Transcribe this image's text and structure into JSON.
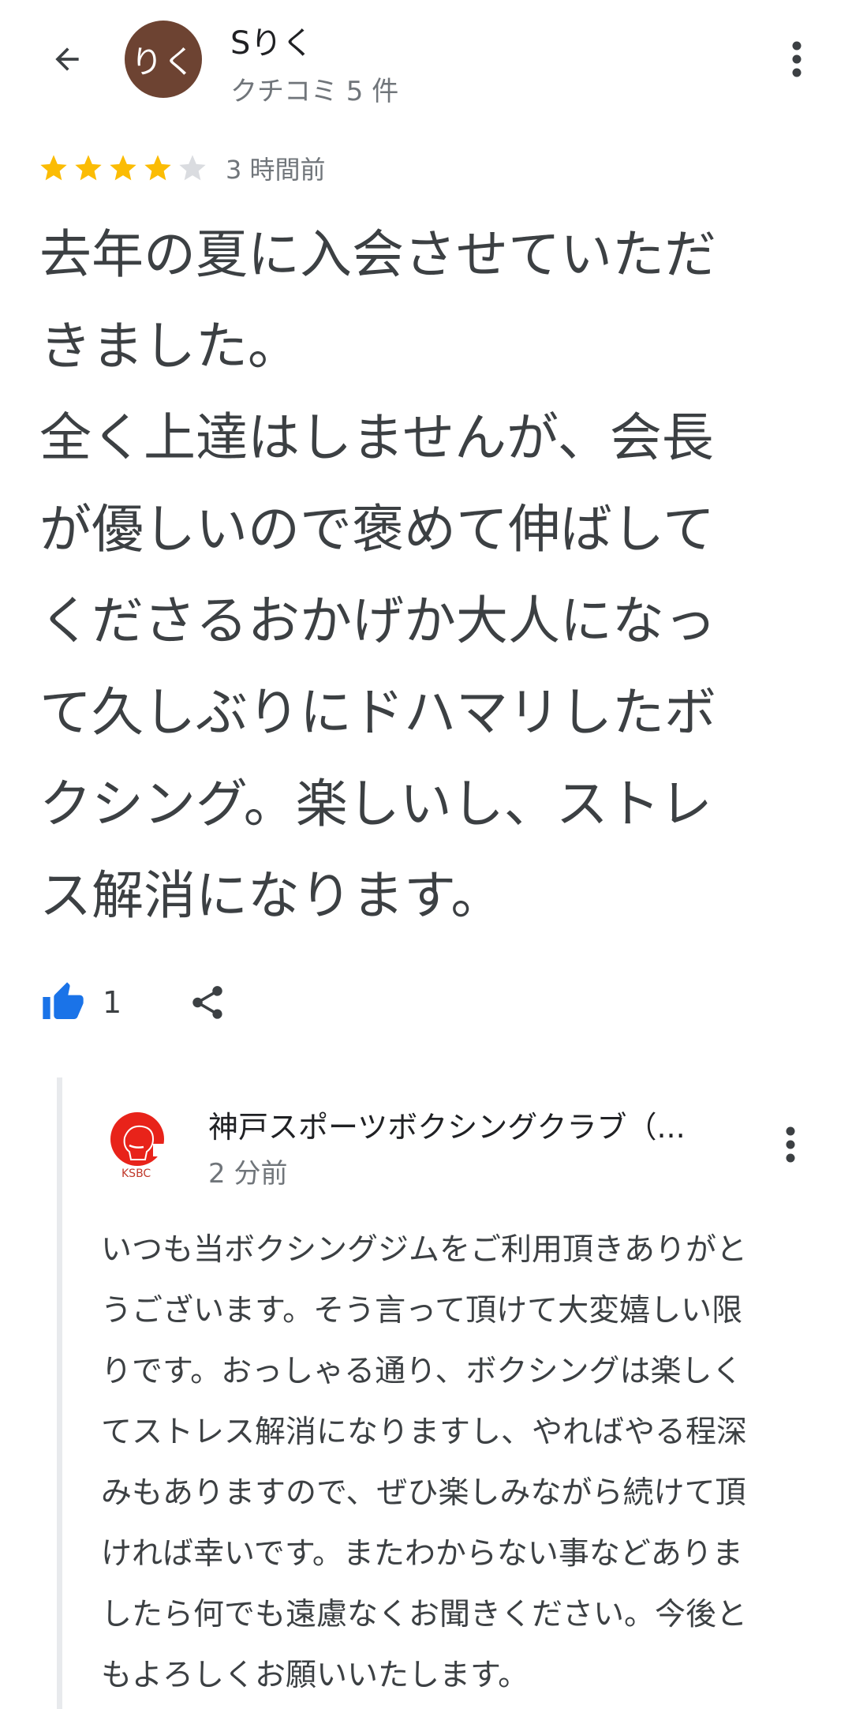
{
  "header": {
    "avatar_text": "りく",
    "avatar_color": "#6d4332",
    "user_name": "Sりく",
    "user_meta": "クチコミ 5 件"
  },
  "review": {
    "rating": 4,
    "max_rating": 5,
    "star_color": "#fbbc04",
    "empty_star_color": "#dadce0",
    "time_ago": "3 時間前",
    "text": "去年の夏に入会させていただ\nきました。\n全く上達はしませんが、会長\nが優しいので褒めて伸ばして\nくださるおかげか大人になっ\nて久しぶりにドハマリしたボ\nクシング。楽しいし、ストレ\nス解消になります。"
  },
  "actions": {
    "like_count": "1",
    "like_color": "#1a73e8"
  },
  "owner_reply": {
    "name": "神戸スポーツボクシングクラブ（...",
    "logo_text": "KSBC",
    "time_ago": "2 分前",
    "text": "いつも当ボクシングジムをご利用頂きありがと\nうございます。そう言って頂けて大変嬉しい限\nりです。おっしゃる通り、ボクシングは楽しく\nてストレス解消になりますし、やればやる程深\nみもありますので、ぜひ楽しみながら続けて頂\nければ幸いです。またわからない事などありま\nしたら何でも遠慮なくお聞きください。今後と\nもよろしくお願いいたします。"
  }
}
